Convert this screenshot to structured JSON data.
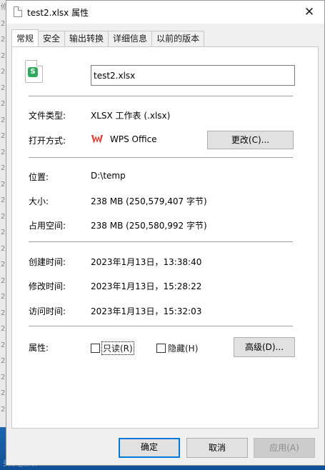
{
  "window": {
    "title": "test2.xlsx 属性",
    "close_glyph": "✕"
  },
  "tabs": [
    {
      "label": "常规",
      "active": true
    },
    {
      "label": "安全",
      "active": false
    },
    {
      "label": "输出转换",
      "active": false
    },
    {
      "label": "详细信息",
      "active": false
    },
    {
      "label": "以前的版本",
      "active": false
    }
  ],
  "general": {
    "file_name": "test2.xlsx",
    "icon_letter": "S",
    "type_label": "文件类型:",
    "type_value": "XLSX 工作表 (.xlsx)",
    "open_with_label": "打开方式:",
    "open_with_value": "WPS Office",
    "change_button": "更改(C)...",
    "location_label": "位置:",
    "location_value": "D:\\temp",
    "size_label": "大小:",
    "size_value": "238 MB (250,579,407 字节)",
    "disk_size_label": "占用空间:",
    "disk_size_value": "238 MB (250,580,992 字节)",
    "created_label": "创建时间:",
    "created_value": "2023年1月13日，13:38:40",
    "modified_label": "修改时间:",
    "modified_value": "2023年1月13日，15:28:22",
    "accessed_label": "访问时间:",
    "accessed_value": "2023年1月13日，15:32:03",
    "attributes_label": "属性:",
    "readonly_label": "只读(R)",
    "readonly_checked": false,
    "hidden_label": "隐藏(H)",
    "hidden_checked": false,
    "advanced_button": "高级(D)..."
  },
  "footer": {
    "ok": "确定",
    "cancel": "取消",
    "apply": "应用(A)"
  },
  "background": {
    "left_chars": [
      "修",
      "2",
      "2",
      "2",
      "2",
      "2",
      "2",
      "2",
      "2",
      "2",
      "2",
      "2",
      "2",
      "2",
      "2",
      "2",
      "2",
      "2",
      "2",
      "2",
      "2",
      "2",
      "2",
      "2",
      "2",
      "2"
    ],
    "watermark": "头条@胖胖"
  },
  "colors": {
    "accent": "#0078d7",
    "wps_red": "#e8362b",
    "xlsx_green": "#2eaa5c",
    "desktop_blue": "#2a6fa8"
  }
}
